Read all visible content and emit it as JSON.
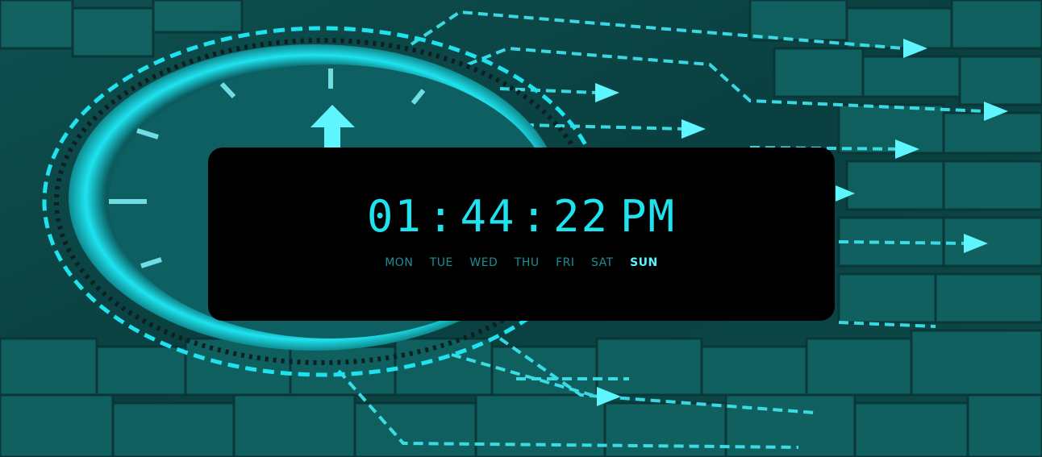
{
  "clock": {
    "hours": "01",
    "separator_1": ":",
    "minutes": "44",
    "separator_2": ":",
    "seconds": "22",
    "period": "PM"
  },
  "days": [
    {
      "label": "MON",
      "active": false
    },
    {
      "label": "TUE",
      "active": false
    },
    {
      "label": "WED",
      "active": false
    },
    {
      "label": "THU",
      "active": false
    },
    {
      "label": "FRI",
      "active": false
    },
    {
      "label": "SAT",
      "active": false
    },
    {
      "label": "SUN",
      "active": true
    }
  ],
  "colors": {
    "accent": "#1ee3ef",
    "day_inactive": "#1a8e97",
    "day_active": "#5ff5ff",
    "panel": "#000000",
    "background": "#0b3f3f"
  },
  "background_icon": "clock-with-arrows-graphic"
}
